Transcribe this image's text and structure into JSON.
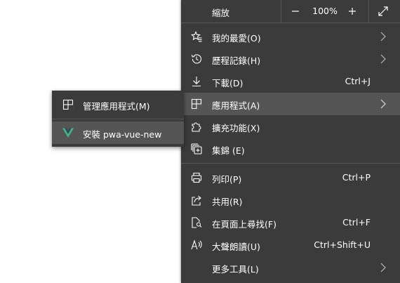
{
  "zoom": {
    "label": "縮放",
    "value": "100%",
    "minus": "−",
    "plus": "+"
  },
  "menu_items": [
    {
      "label": "我的最愛(O)",
      "icon": "favorites-icon",
      "has_submenu": true
    },
    {
      "label": "歷程記錄(H)",
      "icon": "history-icon",
      "has_submenu": true
    },
    {
      "label": "下載(D)",
      "icon": "download-icon",
      "shortcut": "Ctrl+J"
    },
    {
      "label": "應用程式(A)",
      "icon": "apps-icon",
      "has_submenu": true,
      "active": true
    },
    {
      "label": "擴充功能(X)",
      "icon": "extensions-icon"
    },
    {
      "label": "集錦 (E)",
      "icon": "collections-icon"
    },
    {
      "label": "列印(P)",
      "icon": "print-icon",
      "shortcut": "Ctrl+P"
    },
    {
      "label": "共用(R)",
      "icon": "share-icon"
    },
    {
      "label": "在頁面上尋找(F)",
      "icon": "find-icon",
      "shortcut": "Ctrl+F"
    },
    {
      "label": "大聲朗讀(U)",
      "icon": "read-aloud-icon",
      "shortcut": "Ctrl+Shift+U"
    },
    {
      "label": "更多工具(L)",
      "icon": "more-tools-icon",
      "has_submenu": true
    }
  ],
  "apps_submenu": [
    {
      "label": "管理應用程式(M)",
      "icon": "manage-apps-icon"
    },
    {
      "label": "安裝 pwa-vue-new",
      "icon": "vue-logo-icon",
      "active": true
    }
  ],
  "colors": {
    "menu_bg": "#3b3b3b",
    "hover_bg": "#555555",
    "vue_green": "#41b883"
  }
}
